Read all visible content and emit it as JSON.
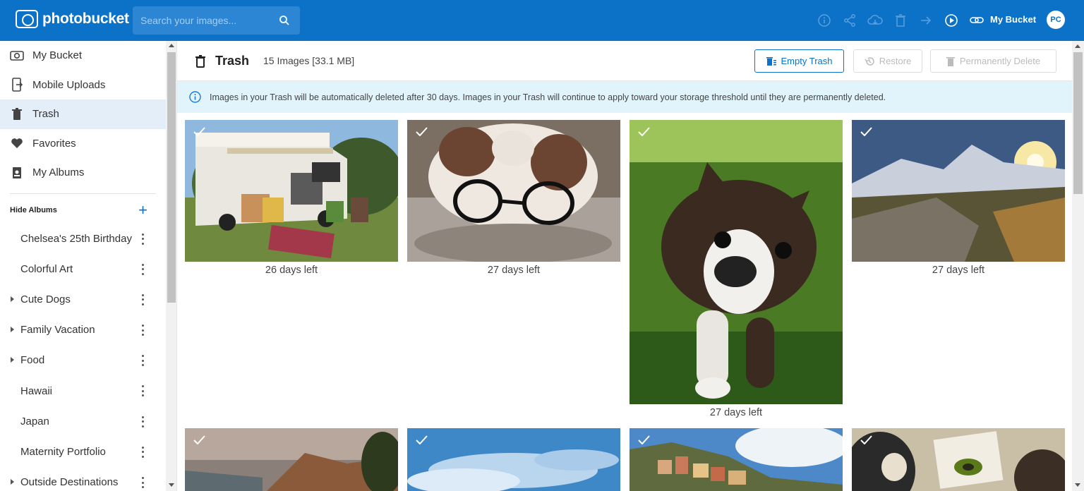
{
  "brand": {
    "name": "photobucket"
  },
  "search": {
    "placeholder": "Search your images..."
  },
  "topbar": {
    "icons": [
      "info-icon",
      "share-icon",
      "cloud-download-icon",
      "trash-icon",
      "move-arrow-icon",
      "play-icon",
      "link-icon"
    ],
    "bucket_label": "My Bucket",
    "avatar_initials": "PC"
  },
  "sidebar": {
    "items": [
      {
        "label": "My Bucket",
        "icon": "bucket-icon"
      },
      {
        "label": "Mobile Uploads",
        "icon": "mobile-upload-icon"
      },
      {
        "label": "Trash",
        "icon": "trash-icon",
        "active": true
      },
      {
        "label": "Favorites",
        "icon": "heart-icon"
      },
      {
        "label": "My Albums",
        "icon": "albums-icon"
      }
    ],
    "albums_toggle": "Hide Albums",
    "add_album": "+",
    "albums": [
      {
        "name": "Chelsea's 25th Birthday",
        "expandable": false
      },
      {
        "name": "Colorful Art",
        "expandable": false
      },
      {
        "name": "Cute Dogs",
        "expandable": true
      },
      {
        "name": "Family Vacation",
        "expandable": true
      },
      {
        "name": "Food",
        "expandable": true
      },
      {
        "name": "Hawaii",
        "expandable": false
      },
      {
        "name": "Japan",
        "expandable": false
      },
      {
        "name": "Maternity Portfolio",
        "expandable": false
      },
      {
        "name": "Outside Destinations",
        "expandable": true
      }
    ]
  },
  "header": {
    "title": "Trash",
    "count": "15 Images [33.1 MB]",
    "empty_trash": "Empty Trash",
    "restore": "Restore",
    "permanently_delete": "Permanently Delete"
  },
  "notice": {
    "text": "Images in your Trash will be automatically deleted after 30 days. Images in your Trash will continue to apply toward your storage threshold until they are permanently deleted."
  },
  "images": [
    {
      "subject": "rv-camping",
      "days_left": "26 days left"
    },
    {
      "subject": "dog-glasses",
      "days_left": "27 days left"
    },
    {
      "subject": "boston-terrier-puppy",
      "days_left": "27 days left"
    },
    {
      "subject": "mountain-sunset",
      "days_left": "27 days left"
    },
    {
      "subject": "coastal-cliffs",
      "days_left": ""
    },
    {
      "subject": "sky-clouds",
      "days_left": ""
    },
    {
      "subject": "cliffside-village",
      "days_left": ""
    },
    {
      "subject": "kids-crafts",
      "days_left": ""
    }
  ]
}
